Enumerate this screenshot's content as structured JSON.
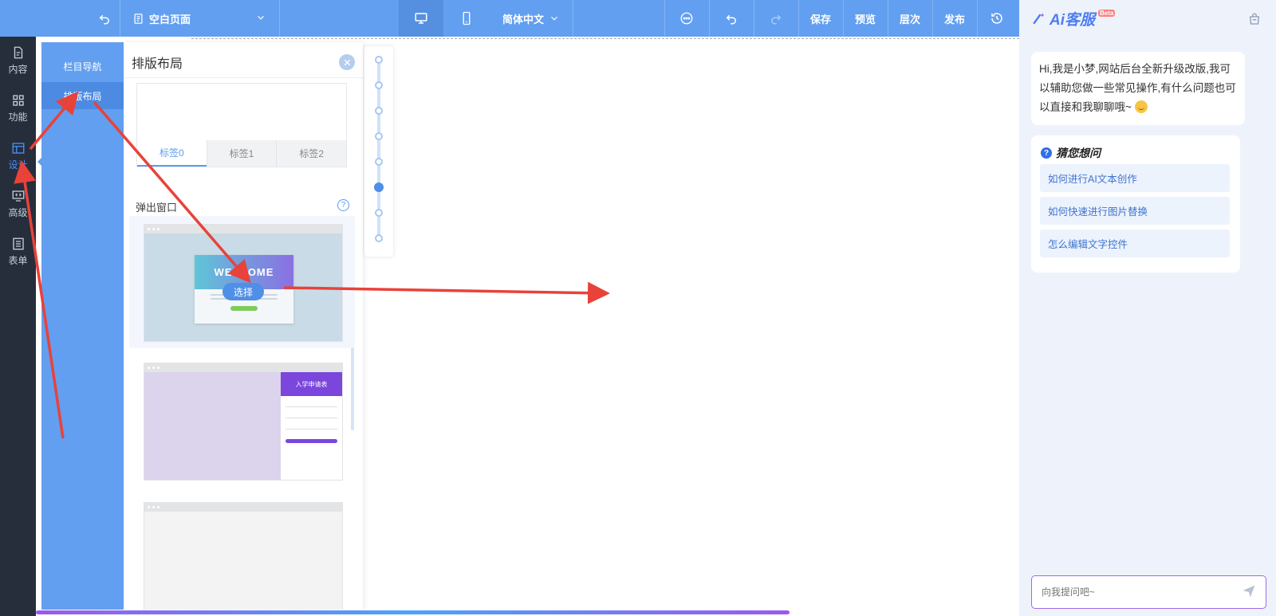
{
  "toolbar": {
    "page_select": "空白页面",
    "language": "简体中文",
    "save": "保存",
    "preview": "预览",
    "layers": "层次",
    "publish": "发布"
  },
  "rail": {
    "items": [
      {
        "label": "内容",
        "icon": "document-icon"
      },
      {
        "label": "功能",
        "icon": "grid-icon"
      },
      {
        "label": "设计",
        "icon": "layout-icon",
        "active": true
      },
      {
        "label": "高级",
        "icon": "code-monitor-icon"
      },
      {
        "label": "表单",
        "icon": "list-form-icon"
      }
    ]
  },
  "subnav": {
    "items": [
      {
        "label": "栏目导航"
      },
      {
        "label": "排版布局",
        "active": true
      }
    ]
  },
  "panel": {
    "title": "排版布局",
    "tabs": [
      "标签0",
      "标签1",
      "标签2"
    ],
    "section_label": "弹出窗口",
    "template1_heading": "WELCOME",
    "template1_select": "选择",
    "template2_heading": "入学申请表"
  },
  "ai": {
    "logo": "Ai客服",
    "beta": "Beta",
    "greeting": "Hi,我是小梦,网站后台全新升级改版,我可以辅助您做一些常见操作,有什么问题也可以直接和我聊聊哦~",
    "guess_title": "猜您想问",
    "questions": [
      "如何进行AI文本创作",
      "如何快速进行图片替换",
      "怎么编辑文字控件"
    ],
    "input_placeholder": "向我提问吧~"
  },
  "colors": {
    "toolbar": "#629ff0",
    "rail": "#262e3c",
    "accent": "#4f8fe6",
    "annotation_arrow": "#e8423a"
  }
}
